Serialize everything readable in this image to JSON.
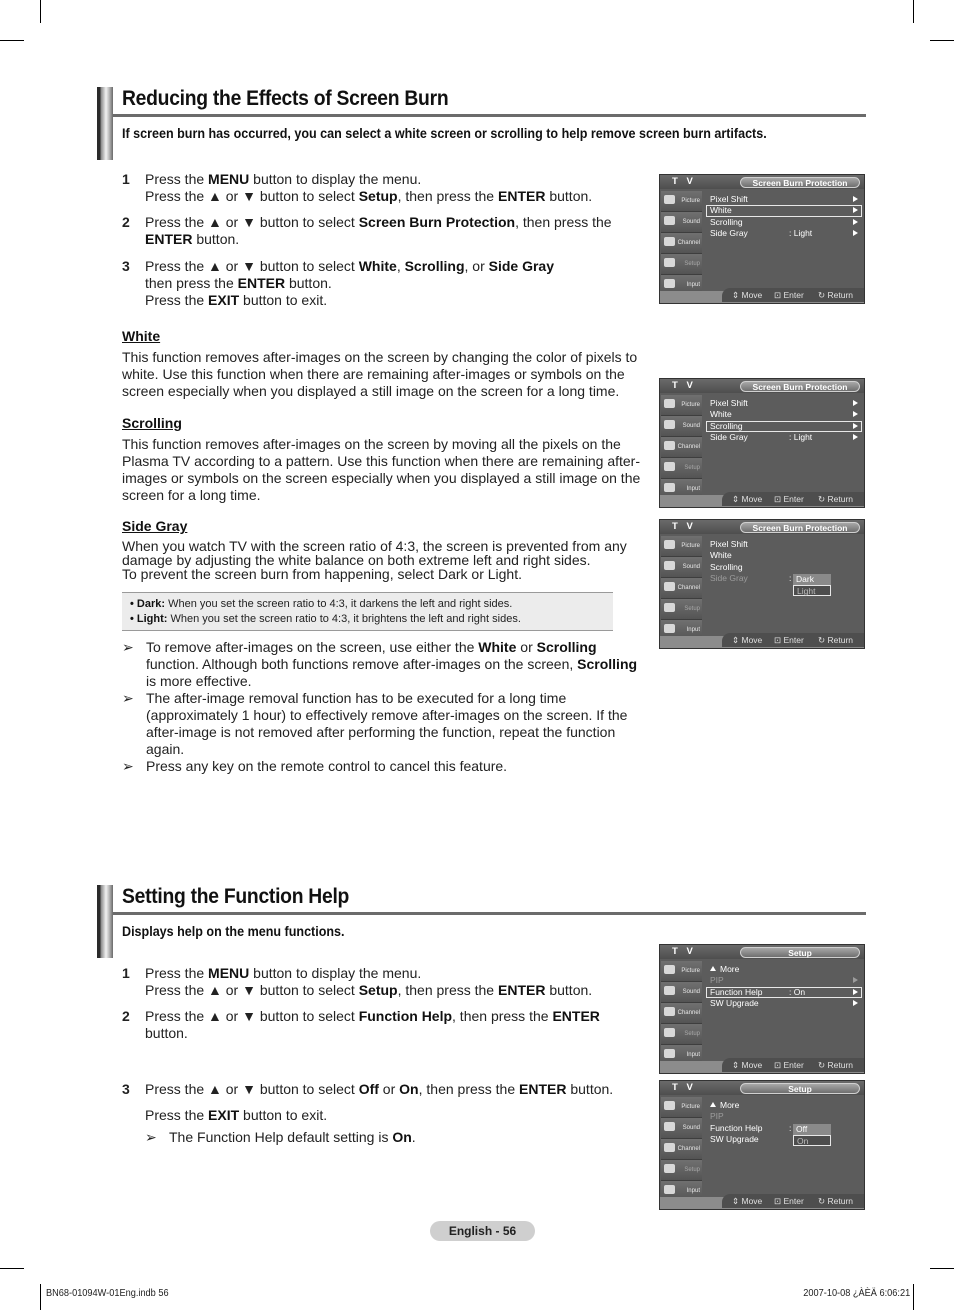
{
  "section1": {
    "title": "Reducing the Effects of Screen Burn",
    "intro": "If screen burn has occurred, you can select a white screen or scrolling to help remove screen burn artifacts.",
    "steps": [
      {
        "num": "1",
        "lines": [
          [
            {
              "t": "Press the "
            },
            {
              "t": "MENU",
              "b": true
            },
            {
              "t": " button to display the menu."
            }
          ],
          [
            {
              "t": "Press the ▲ or ▼ button to select "
            },
            {
              "t": "Setup",
              "b": true
            },
            {
              "t": ", then press the "
            },
            {
              "t": "ENTER",
              "b": true
            },
            {
              "t": " button."
            }
          ]
        ]
      },
      {
        "num": "2",
        "lines": [
          [
            {
              "t": "Press the ▲ or ▼ button to select "
            },
            {
              "t": "Screen Burn Protection",
              "b": true
            },
            {
              "t": ", then press the"
            }
          ],
          [
            {
              "t": "ENTER",
              "b": true
            },
            {
              "t": " button."
            }
          ]
        ]
      },
      {
        "num": "3",
        "lines": [
          [
            {
              "t": "Press the ▲ or ▼ button to select "
            },
            {
              "t": "White",
              "b": true
            },
            {
              "t": ", "
            },
            {
              "t": "Scrolling",
              "b": true
            },
            {
              "t": ", or "
            },
            {
              "t": "Side Gray",
              "b": true
            }
          ],
          [
            {
              "t": "then press the "
            },
            {
              "t": "ENTER",
              "b": true
            },
            {
              "t": " button."
            }
          ],
          [
            {
              "t": "Press the "
            },
            {
              "t": "EXIT",
              "b": true
            },
            {
              "t": " button to exit."
            }
          ]
        ]
      }
    ],
    "white": {
      "heading": "White",
      "lines": [
        "This function removes after-images on the screen by changing the color of pixels to",
        "white. Use this function when there are remaining after-images or symbols on the",
        "screen especially when you displayed a still image on the screen for a long time."
      ]
    },
    "scrolling": {
      "heading": "Scrolling",
      "lines": [
        "This function removes after-images on the screen by moving all the pixels on the",
        "Plasma TV according to a pattern. Use this function when there are remaining after-",
        "images or symbols on the screen especially when you displayed a still image on the",
        "screen for a long time."
      ]
    },
    "side_gray": {
      "heading": "Side Gray",
      "lines": [
        "When you watch TV with the screen ratio of 4:3, the screen is prevented from any",
        "damage by adjusting the white balance on both extreme left and right sides.",
        "To prevent the screen burn from happening, select Dark or Light."
      ],
      "notes": [
        {
          "label": "• Dark:",
          "text": " When you set the screen ratio to 4:3, it darkens the left and right sides."
        },
        {
          "label": "• Light:",
          "text": " When you set the screen ratio to 4:3, it brightens the left and right sides."
        }
      ]
    },
    "tips": [
      [
        [
          {
            "t": "To remove after-images on the screen, use either the "
          },
          {
            "t": "White",
            "b": true
          },
          {
            "t": " or "
          },
          {
            "t": "Scrolling",
            "b": true
          }
        ],
        [
          {
            "t": "function. Although both functions remove after-images on the screen, "
          },
          {
            "t": "Scrolling",
            "b": true
          }
        ],
        [
          {
            "t": "is more effective."
          }
        ]
      ],
      [
        [
          {
            "t": "The after-image removal function has to be executed for a long time"
          }
        ],
        [
          {
            "t": "(approximately 1 hour) to effectively remove after-images on the screen. If the"
          }
        ],
        [
          {
            "t": "after-image is not removed after performing the function, repeat the function"
          }
        ],
        [
          {
            "t": "again."
          }
        ]
      ],
      [
        [
          {
            "t": "Press any key on the remote control to cancel this feature."
          }
        ]
      ]
    ]
  },
  "section2": {
    "title": "Setting the Function Help",
    "intro": "Displays help on the menu functions.",
    "steps": [
      {
        "num": "1",
        "lines": [
          [
            {
              "t": "Press the "
            },
            {
              "t": "MENU",
              "b": true
            },
            {
              "t": " button to display the menu."
            }
          ],
          [
            {
              "t": "Press the ▲ or ▼ button to select "
            },
            {
              "t": "Setup",
              "b": true
            },
            {
              "t": ", then press the "
            },
            {
              "t": "ENTER",
              "b": true
            },
            {
              "t": " button."
            }
          ]
        ]
      },
      {
        "num": "2",
        "lines": [
          [
            {
              "t": "Press the ▲ or ▼ button to select "
            },
            {
              "t": "Function Help",
              "b": true
            },
            {
              "t": ", then press the "
            },
            {
              "t": "ENTER",
              "b": true
            }
          ],
          [
            {
              "t": "button."
            }
          ]
        ]
      },
      {
        "num": "3",
        "lines": [
          [
            {
              "t": "Press the ▲ or ▼ button to select "
            },
            {
              "t": "Off",
              "b": true
            },
            {
              "t": " or "
            },
            {
              "t": "On",
              "b": true
            },
            {
              "t": ", then press the "
            },
            {
              "t": "ENTER",
              "b": true
            },
            {
              "t": " button."
            }
          ]
        ]
      }
    ],
    "exit_line": [
      {
        "t": "Press the "
      },
      {
        "t": "EXIT",
        "b": true
      },
      {
        "t": " button to exit."
      }
    ],
    "tip": [
      {
        "t": "The Function Help default setting is "
      },
      {
        "t": "On",
        "b": true
      },
      {
        "t": "."
      }
    ]
  },
  "osd_common": {
    "tv_label": "T V",
    "sidebar": [
      "Picture",
      "Sound",
      "Channel",
      "Setup",
      "Input"
    ],
    "footer": {
      "move": "Move",
      "enter": "Enter",
      "return": "Return"
    },
    "arrow_glyph": "➢"
  },
  "osd_screens": [
    {
      "title": "Screen Burn Protection",
      "rows": [
        {
          "label": "Pixel Shift",
          "arrow": true
        },
        {
          "label": "White",
          "arrow": true,
          "selected": true
        },
        {
          "label": "Scrolling",
          "arrow": true
        },
        {
          "label": "Side Gray",
          "value": ": Light",
          "arrow": true
        }
      ]
    },
    {
      "title": "Screen Burn Protection",
      "rows": [
        {
          "label": "Pixel Shift",
          "arrow": true
        },
        {
          "label": "White",
          "arrow": true
        },
        {
          "label": "Scrolling",
          "arrow": true,
          "selected": true
        },
        {
          "label": "Side Gray",
          "value": ": Light",
          "arrow": true
        }
      ]
    },
    {
      "title": "Screen Burn Protection",
      "rows": [
        {
          "label": "Pixel Shift"
        },
        {
          "label": "White"
        },
        {
          "label": "Scrolling"
        },
        {
          "label": "Side Gray",
          "dim": true
        }
      ],
      "dropdown": {
        "row": 3,
        "options": [
          "Dark",
          "Light"
        ],
        "highlighted": "Dark",
        "current": "Light"
      }
    },
    {
      "title": "Setup",
      "rows": [
        {
          "label": "More",
          "up": true
        },
        {
          "label": "PIP",
          "arrow": true,
          "dim": true
        },
        {
          "label": "Function Help",
          "value": ": On",
          "arrow": true,
          "selected": true
        },
        {
          "label": "SW Upgrade",
          "arrow": true
        }
      ]
    },
    {
      "title": "Setup",
      "rows": [
        {
          "label": "More",
          "up": true
        },
        {
          "label": "PIP",
          "dim": true
        },
        {
          "label": "Function Help"
        },
        {
          "label": "SW Upgrade"
        }
      ],
      "dropdown": {
        "row": 2,
        "options": [
          "Off",
          "On"
        ],
        "highlighted": "Off",
        "current": "On"
      }
    }
  ],
  "page_footer": {
    "page_label": "English - 56",
    "file_name": "BN68-01094W-01Eng.indb   56",
    "timestamp": "2007-10-08   ¿ÀÈÄ 6:06:21"
  }
}
